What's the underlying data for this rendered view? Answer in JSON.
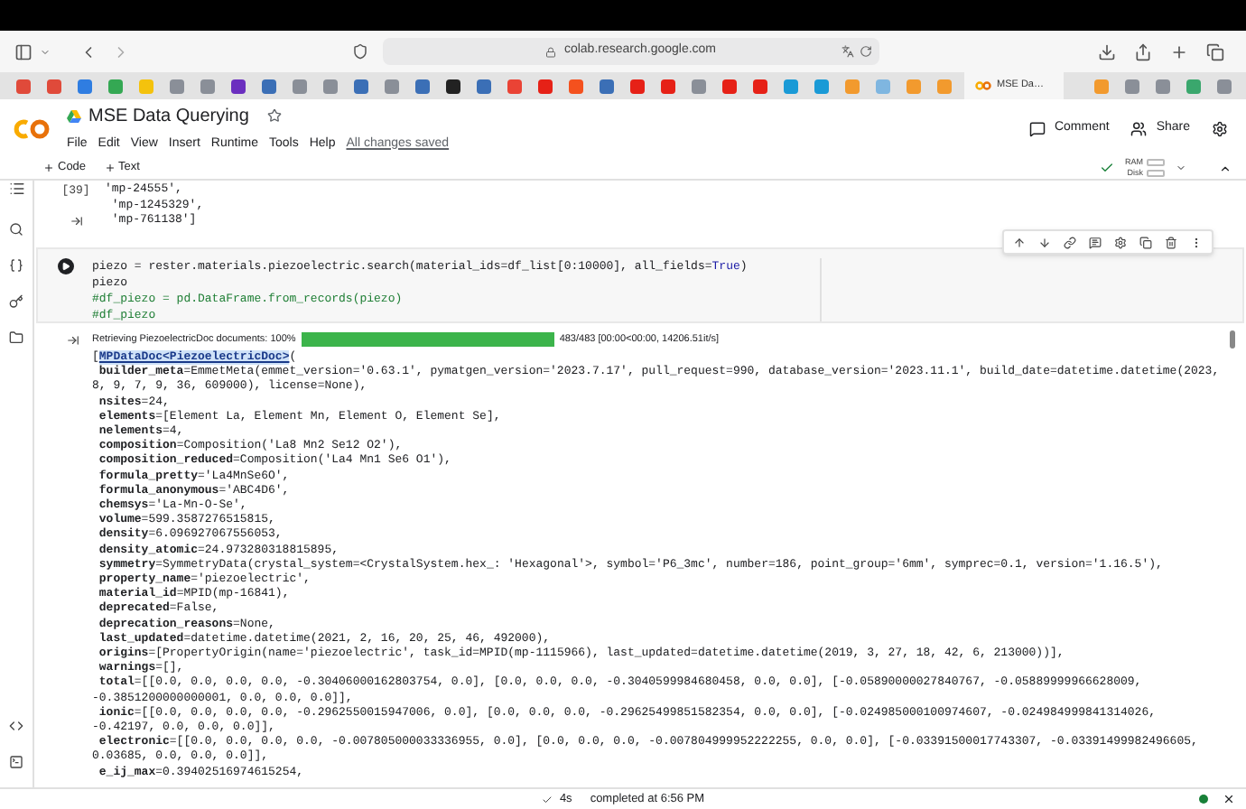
{
  "browser": {
    "url": "colab.research.google.com",
    "tab": "MSE Da…"
  },
  "notebook": {
    "title": "MSE Data Querying",
    "menu": [
      "File",
      "Edit",
      "View",
      "Insert",
      "Runtime",
      "Tools",
      "Help"
    ],
    "save_status": "All changes saved"
  },
  "header_actions": [
    {
      "label": "Comment",
      "kind": "comment"
    },
    {
      "label": "Share",
      "kind": "share"
    }
  ],
  "toolbar": {
    "add_buttons": [
      "Code",
      "Text"
    ],
    "resources": [
      "RAM",
      "Disk"
    ]
  },
  "previous_cell": {
    "count": "[39]",
    "output": [
      "'mp-24555',",
      "'mp-1245329',",
      "'mp-761138']"
    ]
  },
  "code_cell": {
    "lines": [
      [
        {
          "text": "piezo = rester.materials.piezoelectric.search(material_ids=df_list[0:10000], all_fields=",
          "kind": "plain"
        },
        {
          "text": "True",
          "kind": "keyword"
        },
        {
          "text": ")",
          "kind": "plain"
        }
      ],
      [
        {
          "text": "piezo",
          "kind": "plain"
        }
      ],
      [
        {
          "text": "#df_piezo = pd.DataFrame.from_records(piezo)",
          "kind": "comment"
        }
      ],
      [
        {
          "text": "#df_piezo",
          "kind": "comment"
        }
      ]
    ]
  },
  "progress": {
    "label": "Retrieving PiezoelectricDoc documents: 100%",
    "level": 1,
    "stats": "483/483 [00:00<00:00, 14206.51it/s]"
  },
  "output": {
    "head": {
      "prefix": "[",
      "link": "MPDataDoc<PiezoelectricDoc>",
      "suffix": "("
    },
    "lines": [
      {
        "key": "builder_meta",
        "value": "=EmmetMeta(emmet_version='0.63.1', pymatgen_version='2023.7.17', pull_request=990, database_version='2023.11.1', build_date=datetime.datetime(2023,"
      },
      {
        "value": "8, 9, 7, 9, 36, 609000), license=None),"
      },
      {
        "key": "nsites",
        "value": "=24,"
      },
      {
        "key": "elements",
        "value": "=[Element La, Element Mn, Element O, Element Se],"
      },
      {
        "key": "nelements",
        "value": "=4,"
      },
      {
        "key": "composition",
        "value": "=Composition('La8 Mn2 Se12 O2'),"
      },
      {
        "key": "composition_reduced",
        "value": "=Composition('La4 Mn1 Se6 O1'),"
      },
      {
        "key": "formula_pretty",
        "value": "='La4MnSe6O',"
      },
      {
        "key": "formula_anonymous",
        "value": "='ABC4D6',"
      },
      {
        "key": "chemsys",
        "value": "='La-Mn-O-Se',"
      },
      {
        "key": "volume",
        "value": "=599.3587276515815,"
      },
      {
        "key": "density",
        "value": "=6.096927067556053,"
      },
      {
        "key": "density_atomic",
        "value": "=24.973280318815895,"
      },
      {
        "key": "symmetry",
        "value": "=SymmetryData(crystal_system=<CrystalSystem.hex_: 'Hexagonal'>, symbol='P6_3mc', number=186, point_group='6mm', symprec=0.1, version='1.16.5'),"
      },
      {
        "key": "property_name",
        "value": "='piezoelectric',"
      },
      {
        "key": "material_id",
        "value": "=MPID(mp-16841),"
      },
      {
        "key": "deprecated",
        "value": "=False,"
      },
      {
        "key": "deprecation_reasons",
        "value": "=None,"
      },
      {
        "key": "last_updated",
        "value": "=datetime.datetime(2021, 2, 16, 20, 25, 46, 492000),"
      },
      {
        "key": "origins",
        "value": "=[PropertyOrigin(name='piezoelectric', task_id=MPID(mp-1115966), last_updated=datetime.datetime(2019, 3, 27, 18, 42, 6, 213000))],"
      },
      {
        "key": "warnings",
        "value": "=[],"
      },
      {
        "key": "total",
        "value": "=[[0.0, 0.0, 0.0, 0.0, -0.30406000162803754, 0.0], [0.0, 0.0, 0.0, -0.3040599984680458, 0.0, 0.0], [-0.05890000027840767, -0.05889999966628009,"
      },
      {
        "value": "-0.3851200000000001, 0.0, 0.0, 0.0]],"
      },
      {
        "key": "ionic",
        "value": "=[[0.0, 0.0, 0.0, 0.0, -0.2962550015947006, 0.0], [0.0, 0.0, 0.0, -0.29625499851582354, 0.0, 0.0], [-0.024985000100974607, -0.024984999841314026,"
      },
      {
        "value": "-0.42197, 0.0, 0.0, 0.0]],"
      },
      {
        "key": "electronic",
        "value": "=[[0.0, 0.0, 0.0, 0.0, -0.007805000033336955, 0.0], [0.0, 0.0, 0.0, -0.007804999952222255, 0.0, 0.0], [-0.03391500017743307, -0.03391499982496605,"
      },
      {
        "value": "0.03685, 0.0, 0.0, 0.0]],"
      },
      {
        "key": "e_ij_max",
        "value": "=0.39402516974615254,"
      }
    ]
  },
  "status_bar": {
    "duration": "4s",
    "message": "completed at 6:56 PM"
  }
}
